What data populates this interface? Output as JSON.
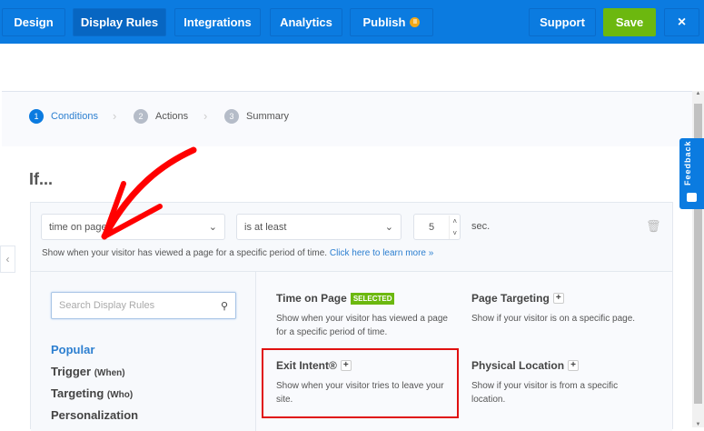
{
  "nav": {
    "design": "Design",
    "display_rules": "Display Rules",
    "integrations": "Integrations",
    "analytics": "Analytics",
    "publish": "Publish",
    "publish_badge": "II",
    "support": "Support",
    "save": "Save",
    "close": "×"
  },
  "steps": [
    {
      "num": "1",
      "label": "Conditions"
    },
    {
      "num": "2",
      "label": "Actions"
    },
    {
      "num": "3",
      "label": "Summary"
    }
  ],
  "heading": "If...",
  "rule": {
    "condition": "time on page",
    "operator": "is at least",
    "value": "5",
    "unit": "sec.",
    "description": "Show when your visitor has viewed a page for a specific period of time.",
    "learn_more": "Click here to learn more »"
  },
  "search": {
    "placeholder": "Search Display Rules"
  },
  "categories": [
    {
      "label": "Popular",
      "sub": ""
    },
    {
      "label": "Trigger",
      "sub": "(When)"
    },
    {
      "label": "Targeting",
      "sub": "(Who)"
    },
    {
      "label": "Personalization",
      "sub": ""
    }
  ],
  "cards": [
    {
      "title": "Time on Page",
      "badge": "SELECTED",
      "desc": "Show when your visitor has viewed a page for a specific period of time."
    },
    {
      "title": "Page Targeting",
      "badge": "+",
      "desc": "Show if your visitor is on a specific page."
    },
    {
      "title": "Exit Intent®",
      "badge": "+",
      "desc": "Show when your visitor tries to leave your site."
    },
    {
      "title": "Physical Location",
      "badge": "+",
      "desc": "Show if your visitor is from a specific location."
    }
  ],
  "feedback": "Feedback",
  "colors": {
    "brand": "#0b7be0",
    "save": "#6cb80f",
    "highlight": "#e01010",
    "annotation_arrow": "#ff0000"
  }
}
